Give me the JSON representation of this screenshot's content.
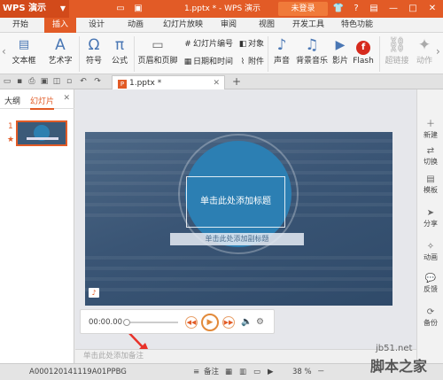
{
  "titlebar": {
    "app_name": "WPS 演示",
    "doc_title": "1.pptx * - WPS 演示",
    "login": "未登录"
  },
  "menu": {
    "tabs": [
      "开始",
      "插入",
      "设计",
      "动画",
      "幻灯片放映",
      "审阅",
      "视图",
      "开发工具",
      "特色功能"
    ],
    "active": "插入"
  },
  "ribbon": {
    "textbox": "文本框",
    "wordart": "艺术字",
    "symbol": "符号",
    "formula": "公式",
    "header_footer": "页眉和页脚",
    "slide_number": "幻灯片编号",
    "datetime": "日期和时间",
    "object": "对象",
    "attachment": "附件",
    "sound": "声音",
    "bg_music": "背景音乐",
    "video": "影片",
    "flash": "Flash",
    "hyperlink": "超链接",
    "action": "动作"
  },
  "doc_tab": {
    "name": "1.pptx *"
  },
  "left_pane": {
    "tab_outline": "大纲",
    "tab_slides": "幻灯片",
    "slide_number": "1"
  },
  "slide": {
    "title_placeholder": "单击此处添加标题",
    "subtitle_placeholder": "单击此处添加副标题"
  },
  "player": {
    "time": "00:00.00"
  },
  "notes": {
    "placeholder": "单击此处添加备注"
  },
  "right_sidebar": [
    "新建",
    "切换",
    "模板",
    "分享",
    "动画",
    "反馈",
    "备份"
  ],
  "statusbar": {
    "filename": "A000120141119A01PPBG",
    "notes_label": "备注",
    "zoom": "38 %"
  },
  "watermark": {
    "line1": "jb51.net",
    "line2": "脚本之家"
  },
  "colors": {
    "accent": "#e25b26",
    "slide_bg": "#3a5575",
    "title_circle": "#2c7fb3"
  }
}
